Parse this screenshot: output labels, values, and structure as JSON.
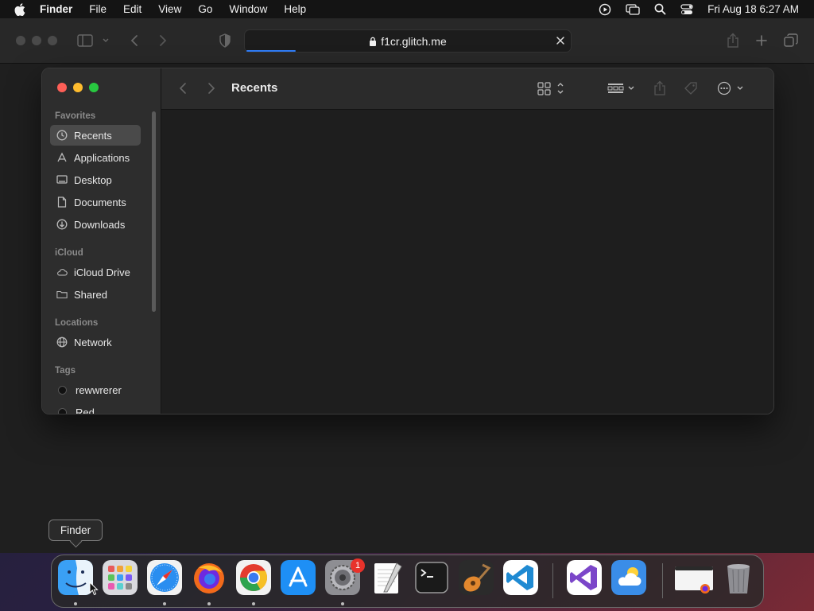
{
  "menubar": {
    "app_name": "Finder",
    "items": [
      "File",
      "Edit",
      "View",
      "Go",
      "Window",
      "Help"
    ],
    "clock": "Fri Aug 18  6:27 AM",
    "status_icons": [
      "screen-record-icon",
      "screen-mirroring-icon",
      "spotlight-search-icon",
      "control-center-icon"
    ]
  },
  "browser": {
    "url": "f1cr.glitch.me",
    "icons": [
      "sidebar-toggle-icon",
      "back-icon",
      "forward-icon",
      "privacy-shield-icon",
      "share-icon",
      "new-tab-icon",
      "tab-overview-icon"
    ]
  },
  "finder": {
    "title": "Recents",
    "sidebar": {
      "favorites_header": "Favorites",
      "favorites": [
        {
          "label": "Recents",
          "icon": "clock-icon"
        },
        {
          "label": "Applications",
          "icon": "applications-icon"
        },
        {
          "label": "Desktop",
          "icon": "desktop-icon"
        },
        {
          "label": "Documents",
          "icon": "document-icon"
        },
        {
          "label": "Downloads",
          "icon": "download-icon"
        }
      ],
      "icloud_header": "iCloud",
      "icloud": [
        {
          "label": "iCloud Drive",
          "icon": "cloud-icon"
        },
        {
          "label": "Shared",
          "icon": "shared-folder-icon"
        }
      ],
      "locations_header": "Locations",
      "locations": [
        {
          "label": "Network",
          "icon": "globe-icon"
        }
      ],
      "tags_header": "Tags",
      "tags": [
        {
          "label": "rewwrerer",
          "color": "#111111"
        },
        {
          "label": "Red",
          "color": "#111111"
        }
      ]
    }
  },
  "tooltip": "Finder",
  "dock": {
    "apps": [
      "Finder",
      "Launchpad",
      "Safari",
      "Firefox",
      "Google Chrome",
      "App Store",
      "System Settings",
      "TextEdit",
      "Terminal",
      "GarageBand",
      "Visual Studio Code",
      "Visual Studio",
      "Weather",
      "Window Preview",
      "Trash"
    ],
    "settings_badge": "1"
  }
}
